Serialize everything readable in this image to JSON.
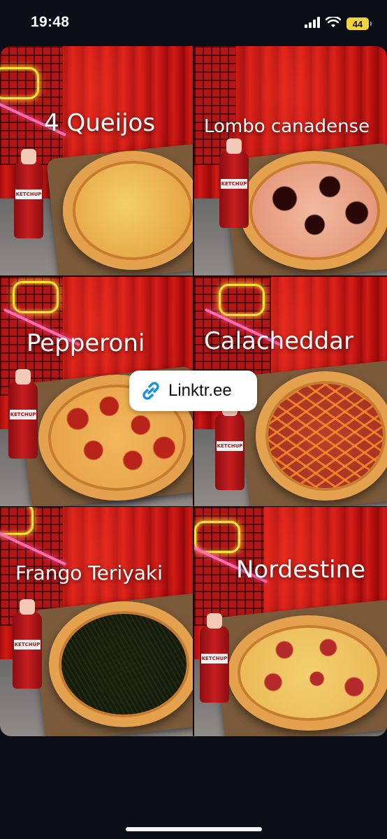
{
  "status_bar": {
    "time": "19:48",
    "battery": "44",
    "icons": [
      "signal-icon",
      "wifi-icon",
      "battery-icon"
    ]
  },
  "story": {
    "tiles": [
      {
        "label": "4 Queijos"
      },
      {
        "label": "Lombo canadense"
      },
      {
        "label": "Pepperoni"
      },
      {
        "label": "Calacheddar"
      },
      {
        "label": "Frango Teriyaki"
      },
      {
        "label": "Nordestine"
      }
    ],
    "link_sticker": {
      "text": "Linktr.ee",
      "icon": "link-icon",
      "color": "#1a8fe0"
    }
  }
}
